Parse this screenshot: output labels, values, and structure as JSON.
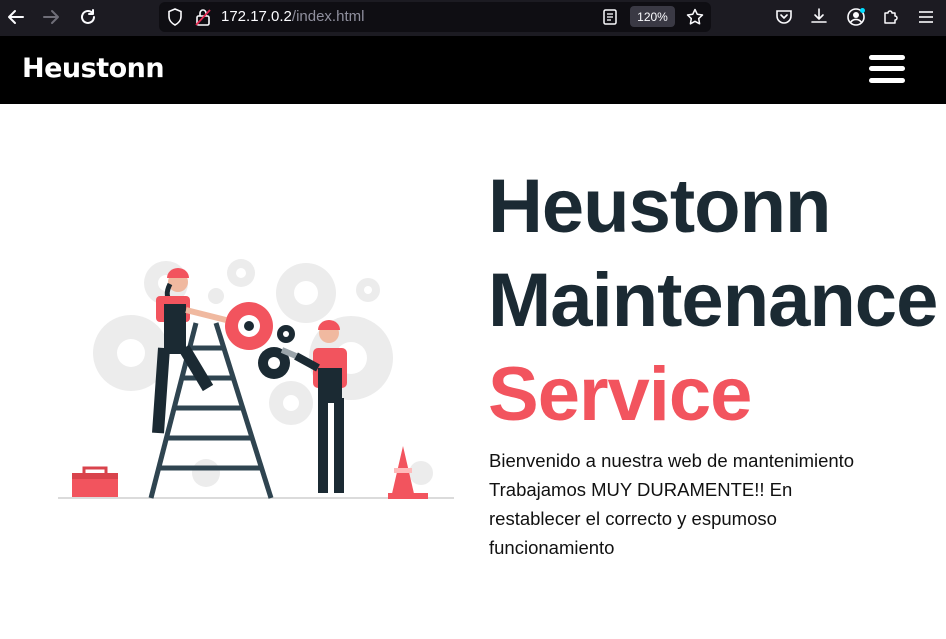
{
  "browser": {
    "url_host": "172.17.0.2",
    "url_path": "/index.html",
    "zoom": "120%",
    "icons": [
      "back-arrow-icon",
      "forward-arrow-icon",
      "reload-icon",
      "shield-icon",
      "insecure-lock-icon",
      "reader-view-icon",
      "bookmark-star-icon",
      "pocket-icon",
      "download-icon",
      "account-icon",
      "extensions-icon",
      "menu-icon"
    ]
  },
  "site": {
    "brand": "Heustonn",
    "menu_icon": "hamburger-menu-icon"
  },
  "hero": {
    "title_line1": "Heustonn",
    "title_line2": "Maintenance",
    "title_accent": "Service",
    "text_line1": "Bienvenido a nuestra web de mantenimiento",
    "text_line2": "Trabajamos MUY DURAMENTE!! En",
    "text_line3": "restablecer el correcto y espumoso",
    "text_line4": "funcionamiento",
    "illustration": "maintenance-workers-illustration"
  },
  "colors": {
    "header_bg": "#000000",
    "title_dark": "#1b2a33",
    "accent": "#f2545e",
    "browser_bg": "#1c1b22"
  }
}
